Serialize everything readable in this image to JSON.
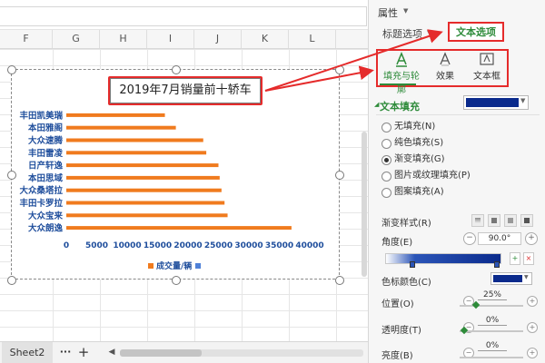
{
  "colors": {
    "bar": "#f07b1e",
    "label": "#1f4e9c",
    "accent_green": "#2e8b3a",
    "callout_red": "#e52b2b",
    "fill_color": "#0a2a8c"
  },
  "sheet": {
    "columns": [
      "F",
      "G",
      "H",
      "I",
      "J",
      "K",
      "L"
    ],
    "tabs": {
      "sheet2": "Sheet2",
      "more": "···",
      "add": "+",
      "prev": "◀"
    }
  },
  "chart_data": {
    "type": "bar",
    "orientation": "horizontal",
    "title": "2019年7月销量前十轿车",
    "categories": [
      "丰田凯美瑞",
      "本田雅阁",
      "大众速腾",
      "丰田雷凌",
      "日产轩逸",
      "本田思域",
      "大众桑塔拉",
      "丰田卡罗拉",
      "大众宝来",
      "大众朗逸"
    ],
    "series": [
      {
        "name": "成交量/辆",
        "values": [
          16200,
          18000,
          22500,
          23000,
          25000,
          25200,
          25500,
          26000,
          26500,
          37000
        ]
      }
    ],
    "xticks": [
      "0",
      "5000",
      "10000",
      "15000",
      "20000",
      "25000",
      "30000",
      "35000",
      "40000"
    ],
    "xlim": [
      0,
      40000
    ],
    "legend_position": "bottom",
    "grid": false
  },
  "panel": {
    "title": "属性",
    "tab_title_options": "标题选项",
    "tab_text_options": "文本选项",
    "subtabs": [
      {
        "label": "填充与轮廓",
        "icon": "text-outline-icon"
      },
      {
        "label": "效果",
        "icon": "text-effect-icon"
      },
      {
        "label": "文本框",
        "icon": "textbox-icon"
      }
    ],
    "section_text_fill": "文本填充",
    "fill_options": [
      {
        "label": "无填充(N)",
        "selected": false
      },
      {
        "label": "纯色填充(S)",
        "selected": false
      },
      {
        "label": "渐变填充(G)",
        "selected": true
      },
      {
        "label": "图片或纹理填充(P)",
        "selected": false
      },
      {
        "label": "图案填充(A)",
        "selected": false
      }
    ],
    "gradient_style_label": "渐变样式(R)",
    "angle_label": "角度(E)",
    "angle_value": "90.0°",
    "stop_color_label": "色标颜色(C)",
    "position_label": "位置(O)",
    "position_value": "25%",
    "position_fraction": 0.25,
    "transparency_label": "透明度(T)",
    "transparency_value": "0%",
    "brightness_label": "亮度(B)",
    "brightness_value": "0%"
  }
}
